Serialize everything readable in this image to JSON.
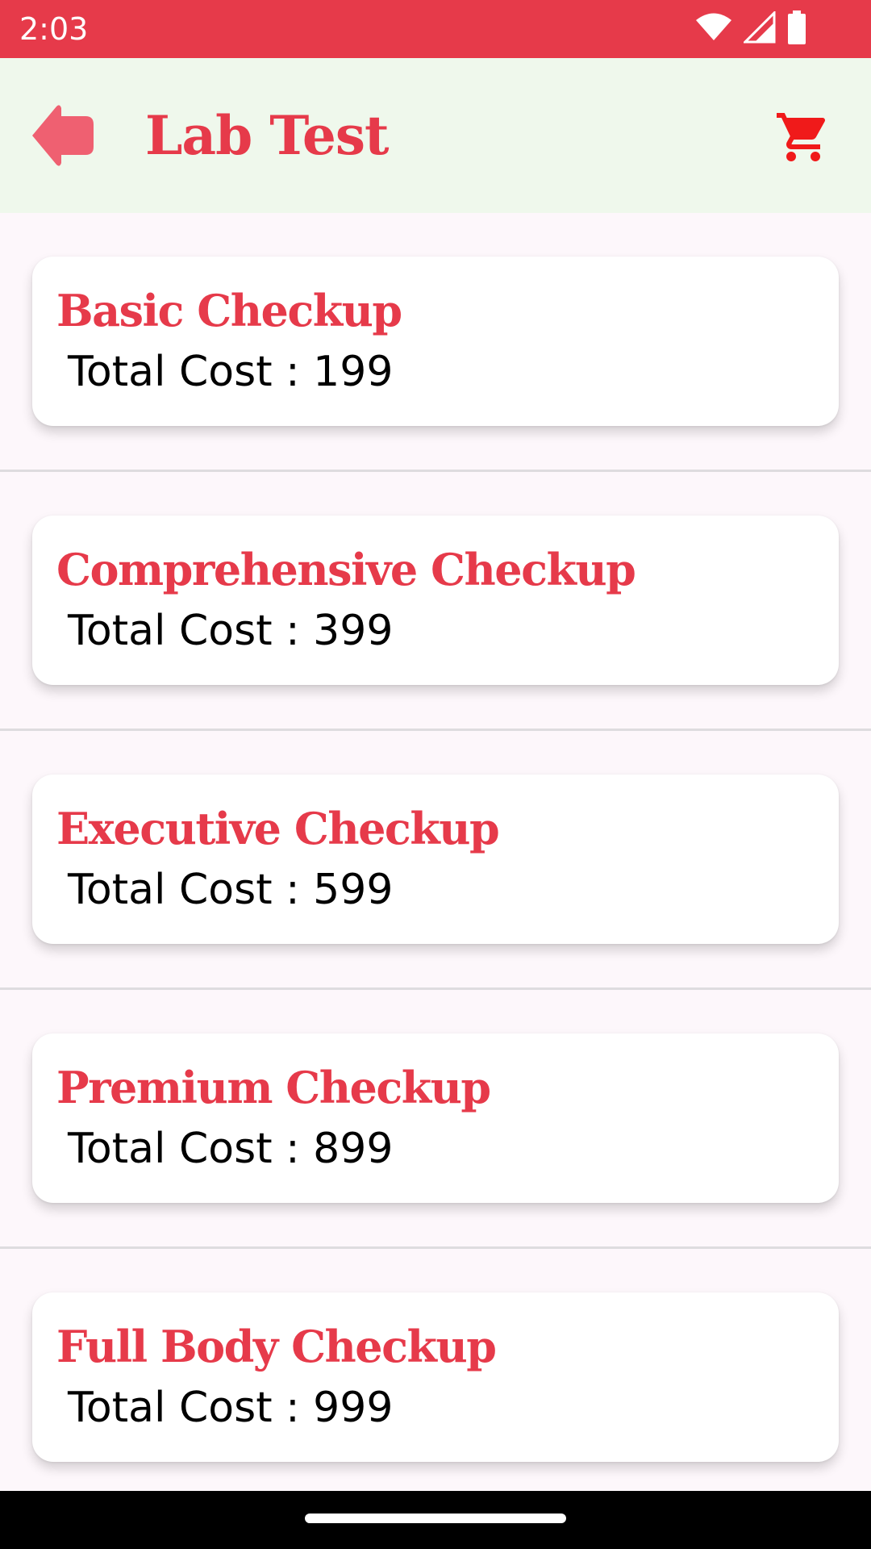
{
  "status_bar": {
    "time": "2:03",
    "color": "#e63a4a",
    "icons": [
      "wifi-icon",
      "cellular-signal-icon",
      "battery-icon"
    ]
  },
  "app_bar": {
    "title": "Lab Test",
    "back_icon": "arrow-left-icon",
    "cart_icon": "shopping-cart-icon",
    "accent_color": "#e63a4a",
    "background_color": "#eff8ec"
  },
  "lab_tests": [
    {
      "name": "Basic Checkup",
      "cost_text": "Total Cost : 199"
    },
    {
      "name": "Comprehensive Checkup",
      "cost_text": "Total Cost : 399"
    },
    {
      "name": "Executive Checkup",
      "cost_text": "Total Cost : 599"
    },
    {
      "name": "Premium Checkup",
      "cost_text": "Total Cost : 899"
    },
    {
      "name": "Full Body Checkup",
      "cost_text": "Total Cost : 999"
    }
  ]
}
